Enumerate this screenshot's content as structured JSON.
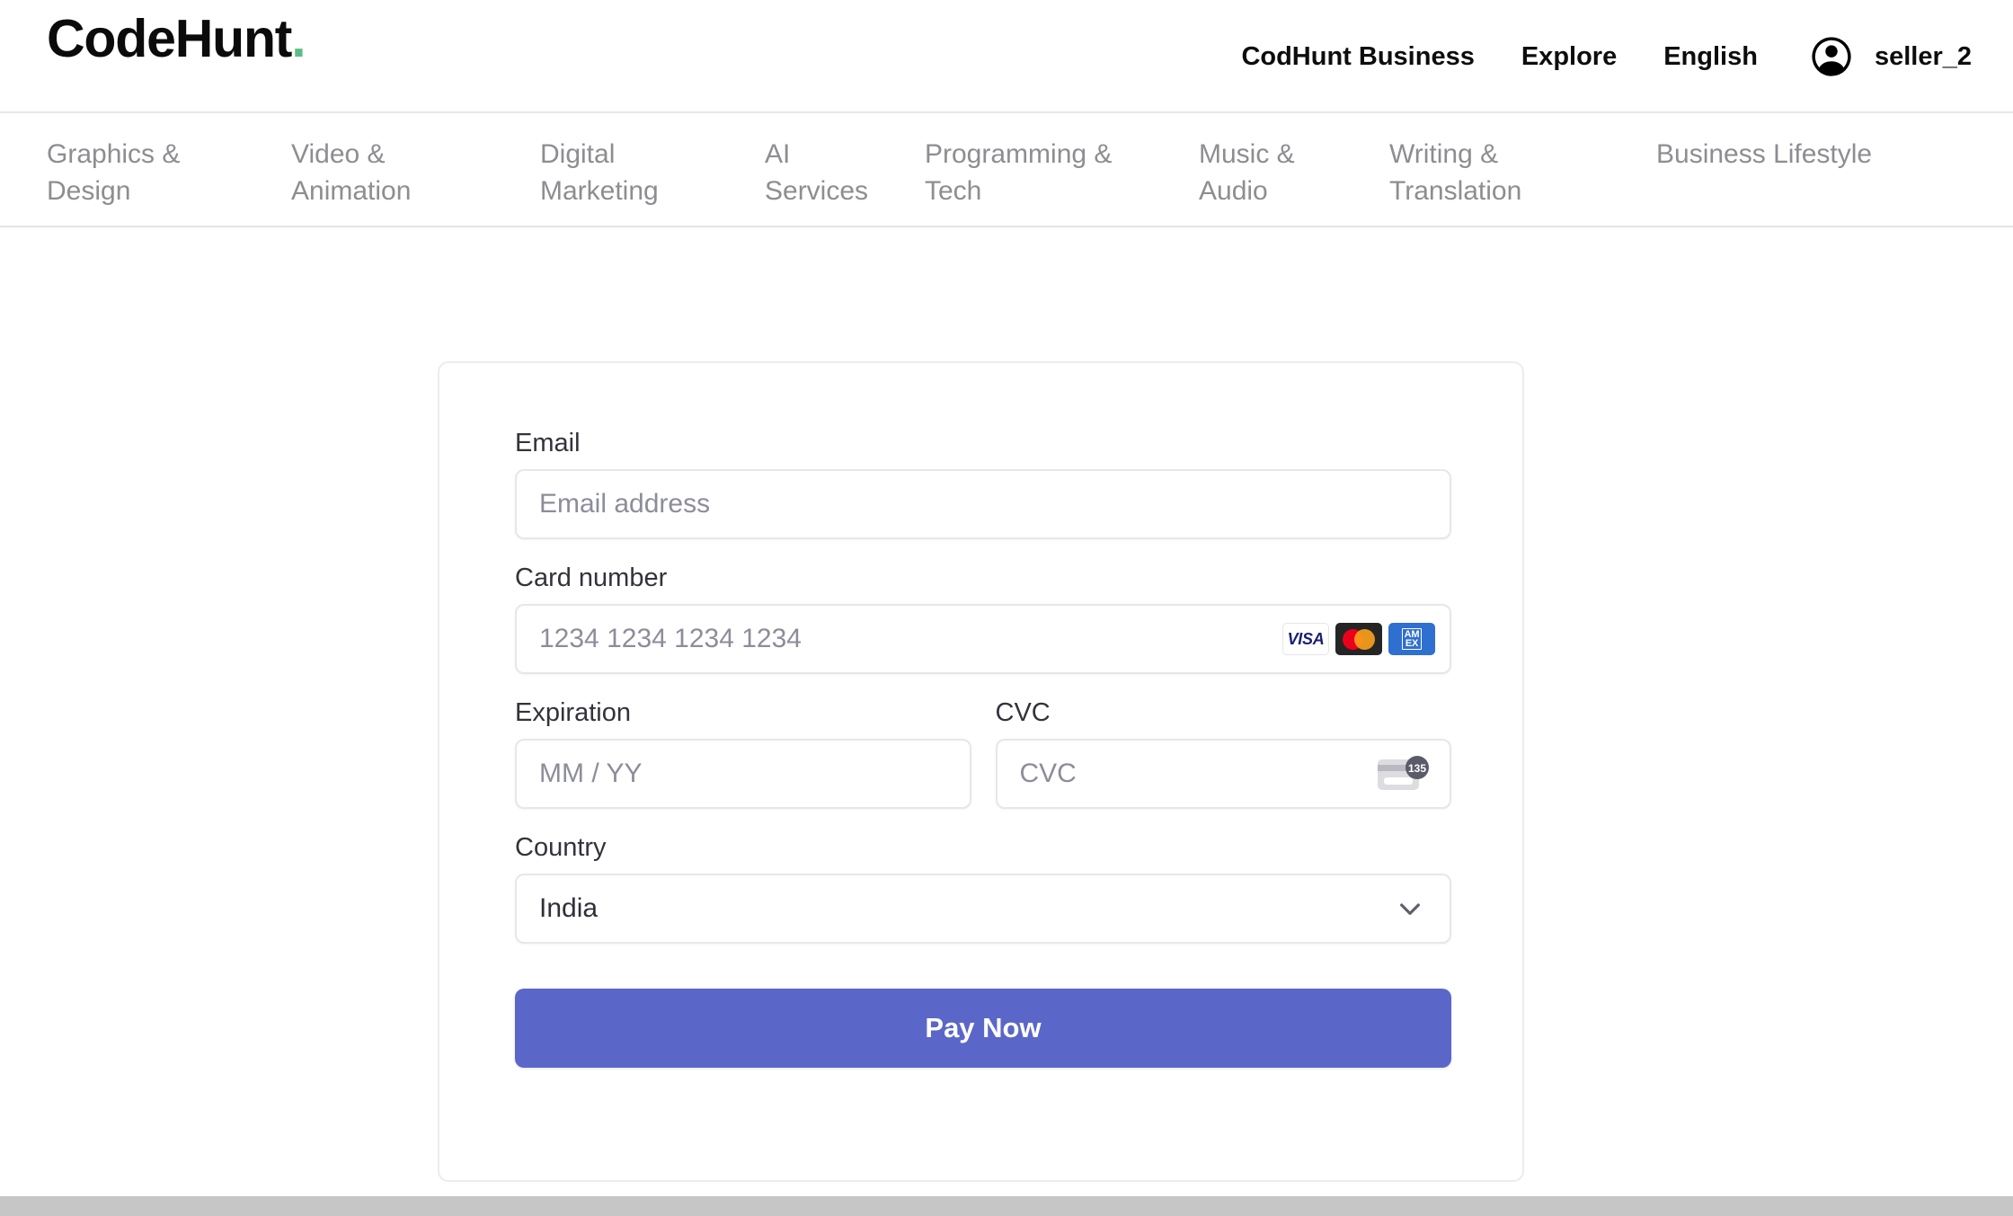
{
  "header": {
    "logo_text": "CodeHunt",
    "logo_dot": ".",
    "logo_dot_color": "#5bbd86",
    "nav": [
      {
        "label": "CodHunt Business",
        "name": "business-link"
      },
      {
        "label": "Explore",
        "name": "explore-link"
      },
      {
        "label": "English",
        "name": "language-link"
      }
    ],
    "account": {
      "icon": "account-circle-icon",
      "username": "seller_2"
    }
  },
  "categories": [
    {
      "label": "Graphics &\nDesign"
    },
    {
      "label": "Video &\nAnimation"
    },
    {
      "label": "Digital\nMarketing"
    },
    {
      "label": "AI\nServices"
    },
    {
      "label": "Programming &\nTech"
    },
    {
      "label": "Music &\nAudio"
    },
    {
      "label": "Writing &\nTranslation"
    },
    {
      "label": "Business Lifestyle"
    }
  ],
  "payment_form": {
    "email": {
      "label": "Email",
      "placeholder": "Email address",
      "value": ""
    },
    "card_number": {
      "label": "Card number",
      "placeholder": "1234 1234 1234 1234",
      "value": "",
      "brands": [
        "visa",
        "mastercard",
        "amex"
      ],
      "visa_text": "VISA",
      "amex_line1": "AM",
      "amex_line2": "EX"
    },
    "expiration": {
      "label": "Expiration",
      "placeholder": "MM / YY",
      "value": ""
    },
    "cvc": {
      "label": "CVC",
      "placeholder": "CVC",
      "value": "",
      "hint_number": "135"
    },
    "country": {
      "label": "Country",
      "selected": "India"
    },
    "submit": {
      "label": "Pay Now",
      "color": "#5a67c8"
    }
  }
}
